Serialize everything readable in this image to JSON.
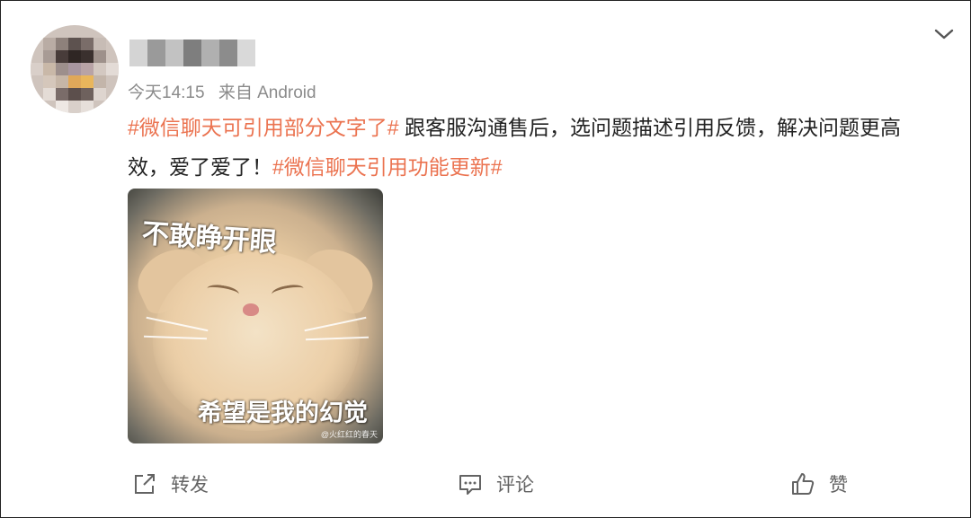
{
  "post": {
    "username_blurred": "",
    "time": "今天14:15",
    "source": "来自 Android",
    "text": {
      "tag1": "#微信聊天可引用部分文字了#",
      "body": " 跟客服沟通售后，选问题描述引用反馈，解决问题更高效，爱了爱了！",
      "tag2": "#微信聊天引用功能更新#"
    },
    "image": {
      "caption_top": "不敢睁开眼",
      "caption_bottom": "希望是我的幻觉",
      "watermark": "@火红红的春天"
    }
  },
  "actions": {
    "repost_label": "转发",
    "comment_label": "评论",
    "like_label": "赞"
  },
  "icons": {
    "menu": "chevron-down-icon",
    "repost": "share-icon",
    "comment": "comment-icon",
    "like": "thumbs-up-icon"
  },
  "colors": {
    "hashtag": "#eb7350",
    "meta": "#8b8b8b",
    "action": "#636363"
  }
}
